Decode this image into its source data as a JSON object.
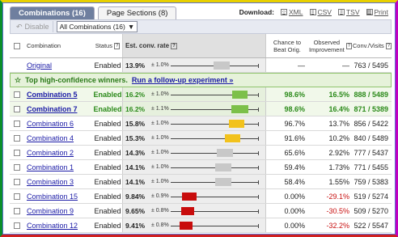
{
  "tabs": [
    {
      "label": "Combinations (16)",
      "active": true
    },
    {
      "label": "Page Sections (8)",
      "active": false
    }
  ],
  "downloads": {
    "label": "Download:",
    "items": [
      {
        "label": "XML",
        "icon": "xml-icon"
      },
      {
        "label": "CSV",
        "icon": "csv-icon"
      },
      {
        "label": "TSV",
        "icon": "tsv-icon"
      },
      {
        "label": "Print",
        "icon": "print-icon"
      }
    ]
  },
  "toolbar": {
    "disable_label": "Disable",
    "filter_value": "All Combinations (16)"
  },
  "headers": {
    "combination": "Combination",
    "status": "Status",
    "rate": "Est. conv. rate",
    "chance": "Chance to Beat Orig.",
    "improvement": "Observed Improvement",
    "conv": "Conv./Visits",
    "help": "?"
  },
  "banner": {
    "text": "Top high-confidence winners.",
    "link": "Run a follow-up experiment »"
  },
  "colors": {
    "green_bar": "#7cc04a",
    "yellow_bar": "#f2c21c",
    "gray_bar": "#c8c8c8",
    "red_bar": "#c80c0c",
    "green_text": "#2b8a1a",
    "red_text": "#c81010"
  },
  "rows": [
    {
      "name": "Original",
      "status": "Enabled",
      "rate": "13.9%",
      "pm": "± 1.0%",
      "chance": "—",
      "improvement": "—",
      "conv": "763 / 5495",
      "rate_value": 13.9,
      "ci": 1.0,
      "kind": "orig"
    },
    {
      "name": "Combination 5",
      "status": "Enabled",
      "rate": "16.2%",
      "pm": "± 1.0%",
      "chance": "98.6%",
      "improvement": "16.5%",
      "conv": "888 / 5489",
      "rate_value": 16.2,
      "ci": 1.0,
      "kind": "win"
    },
    {
      "name": "Combination 7",
      "status": "Enabled",
      "rate": "16.2%",
      "pm": "± 1.1%",
      "chance": "98.6%",
      "improvement": "16.4%",
      "conv": "871 / 5389",
      "rate_value": 16.2,
      "ci": 1.1,
      "kind": "win"
    },
    {
      "name": "Combination 6",
      "status": "Enabled",
      "rate": "15.8%",
      "pm": "± 1.0%",
      "chance": "96.7%",
      "improvement": "13.7%",
      "conv": "856 / 5422",
      "rate_value": 15.8,
      "ci": 1.0,
      "kind": "up"
    },
    {
      "name": "Combination 4",
      "status": "Enabled",
      "rate": "15.3%",
      "pm": "± 1.0%",
      "chance": "91.6%",
      "improvement": "10.2%",
      "conv": "840 / 5489",
      "rate_value": 15.3,
      "ci": 1.0,
      "kind": "up"
    },
    {
      "name": "Combination 2",
      "status": "Enabled",
      "rate": "14.3%",
      "pm": "± 1.0%",
      "chance": "65.6%",
      "improvement": "2.92%",
      "conv": "777 / 5437",
      "rate_value": 14.3,
      "ci": 1.0,
      "kind": "mid"
    },
    {
      "name": "Combination 1",
      "status": "Enabled",
      "rate": "14.1%",
      "pm": "± 1.0%",
      "chance": "59.4%",
      "improvement": "1.73%",
      "conv": "771 / 5455",
      "rate_value": 14.1,
      "ci": 1.0,
      "kind": "mid"
    },
    {
      "name": "Combination 3",
      "status": "Enabled",
      "rate": "14.1%",
      "pm": "± 1.0%",
      "chance": "58.4%",
      "improvement": "1.55%",
      "conv": "759 / 5383",
      "rate_value": 14.1,
      "ci": 1.0,
      "kind": "mid"
    },
    {
      "name": "Combination 15",
      "status": "Enabled",
      "rate": "9.84%",
      "pm": "± 0.9%",
      "chance": "0.00%",
      "improvement": "-29.1%",
      "conv": "519 / 5274",
      "rate_value": 9.84,
      "ci": 0.9,
      "kind": "lose"
    },
    {
      "name": "Combination 9",
      "status": "Enabled",
      "rate": "9.65%",
      "pm": "± 0.8%",
      "chance": "0.00%",
      "improvement": "-30.5%",
      "conv": "509 / 5270",
      "rate_value": 9.65,
      "ci": 0.8,
      "kind": "lose"
    },
    {
      "name": "Combination 12",
      "status": "Enabled",
      "rate": "9.41%",
      "pm": "± 0.8%",
      "chance": "0.00%",
      "improvement": "-32.2%",
      "conv": "522 / 5547",
      "rate_value": 9.41,
      "ci": 0.8,
      "kind": "lose"
    }
  ]
}
